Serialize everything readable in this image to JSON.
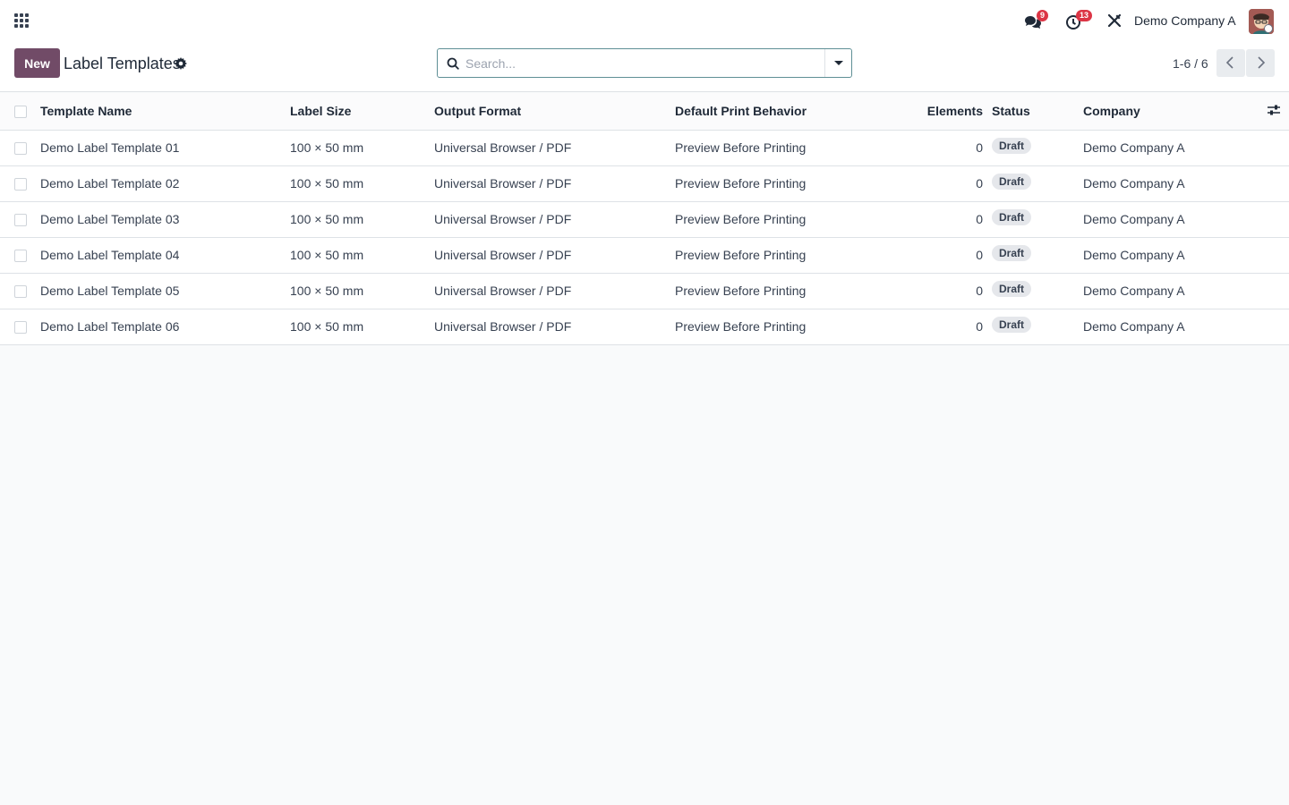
{
  "navbar": {
    "messages_count": "9",
    "activities_count": "13",
    "company": "Demo Company A",
    "icons": [
      "apps-grid-icon",
      "chat-icon",
      "clock-icon",
      "tools-icon"
    ]
  },
  "control": {
    "new_label": "New",
    "title": "Label Templates",
    "search_placeholder": "Search...",
    "pager": "1-6 / 6"
  },
  "table": {
    "headers": {
      "name": "Template Name",
      "size": "Label Size",
      "format": "Output Format",
      "behavior": "Default Print Behavior",
      "elements": "Elements",
      "status": "Status",
      "company": "Company"
    },
    "rows": [
      {
        "name": "Demo Label Template 01",
        "size": "100 × 50 mm",
        "format": "Universal Browser / PDF",
        "behavior": "Preview Before Printing",
        "elements": "0",
        "status": "Draft",
        "company": "Demo Company A"
      },
      {
        "name": "Demo Label Template 02",
        "size": "100 × 50 mm",
        "format": "Universal Browser / PDF",
        "behavior": "Preview Before Printing",
        "elements": "0",
        "status": "Draft",
        "company": "Demo Company A"
      },
      {
        "name": "Demo Label Template 03",
        "size": "100 × 50 mm",
        "format": "Universal Browser / PDF",
        "behavior": "Preview Before Printing",
        "elements": "0",
        "status": "Draft",
        "company": "Demo Company A"
      },
      {
        "name": "Demo Label Template 04",
        "size": "100 × 50 mm",
        "format": "Universal Browser / PDF",
        "behavior": "Preview Before Printing",
        "elements": "0",
        "status": "Draft",
        "company": "Demo Company A"
      },
      {
        "name": "Demo Label Template 05",
        "size": "100 × 50 mm",
        "format": "Universal Browser / PDF",
        "behavior": "Preview Before Printing",
        "elements": "0",
        "status": "Draft",
        "company": "Demo Company A"
      },
      {
        "name": "Demo Label Template 06",
        "size": "100 × 50 mm",
        "format": "Universal Browser / PDF",
        "behavior": "Preview Before Printing",
        "elements": "0",
        "status": "Draft",
        "company": "Demo Company A"
      }
    ]
  },
  "colors": {
    "primary": "#714b67",
    "badge_red": "#dc3545",
    "search_border": "#5e8f95"
  }
}
